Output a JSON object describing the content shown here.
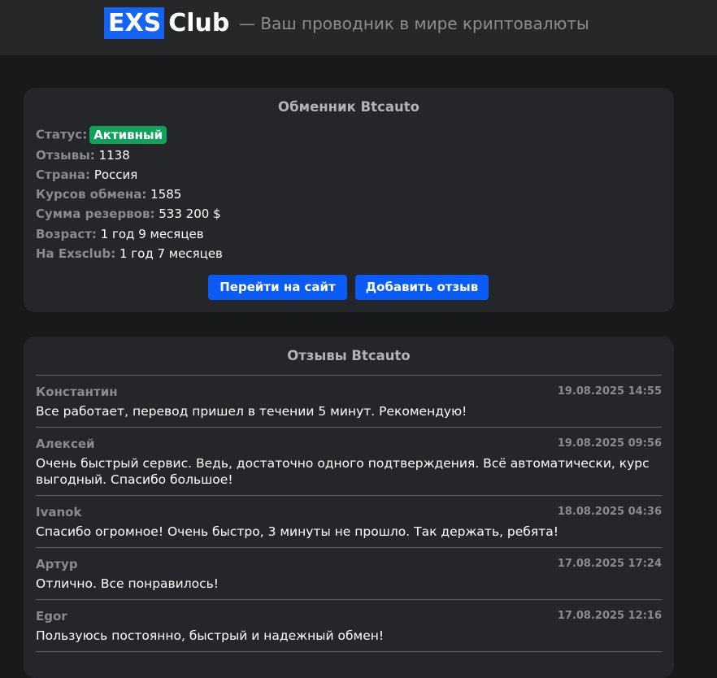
{
  "header": {
    "logo_exs": "EXS",
    "logo_club": "Club",
    "tagline": "— Ваш проводник в мире криптовалюты"
  },
  "exchanger": {
    "title": "Обменник Btcauto",
    "status_label": "Статус:",
    "status_value": "Активный",
    "reviews_label": "Отзывы:",
    "reviews_value": "1138",
    "country_label": "Страна:",
    "country_value": "Россия",
    "rates_label": "Курсов обмена:",
    "rates_value": "1585",
    "reserves_label": "Сумма резервов:",
    "reserves_value": "533 200 $",
    "age_label": "Возраст:",
    "age_value": "1 год 9 месяцев",
    "on_site_label": "На Exsclub:",
    "on_site_value": "1 год 7 месяцев",
    "visit_button": "Перейти на сайт",
    "add_review_button": "Добавить отзыв"
  },
  "reviews": {
    "title": "Отзывы Btcauto",
    "items": [
      {
        "author": "Константин",
        "date": "19.08.2025 14:55",
        "text": "Все работает, перевод пришел в течении 5 минут. Рекомендую!"
      },
      {
        "author": "Алексей",
        "date": "19.08.2025 09:56",
        "text": "Очень быстрый сервис. Ведь, достаточно одного подтверждения. Всё автоматически, курс выгодный. Спасибо большое!"
      },
      {
        "author": "Ivanok",
        "date": "18.08.2025 04:36",
        "text": "Спасибо огромное! Очень быстро, 3 минуты не прошло. Так держать, ребята!"
      },
      {
        "author": "Артур",
        "date": "17.08.2025 17:24",
        "text": "Отлично. Все понравилось!"
      },
      {
        "author": "Egor",
        "date": "17.08.2025 12:16",
        "text": "Пользуюсь постоянно, быстрый и надежный обмен!"
      }
    ]
  },
  "colors": {
    "accent": "#0b5cf6",
    "status_active": "#12a15b",
    "background": "#18191b",
    "card": "#25262a"
  }
}
